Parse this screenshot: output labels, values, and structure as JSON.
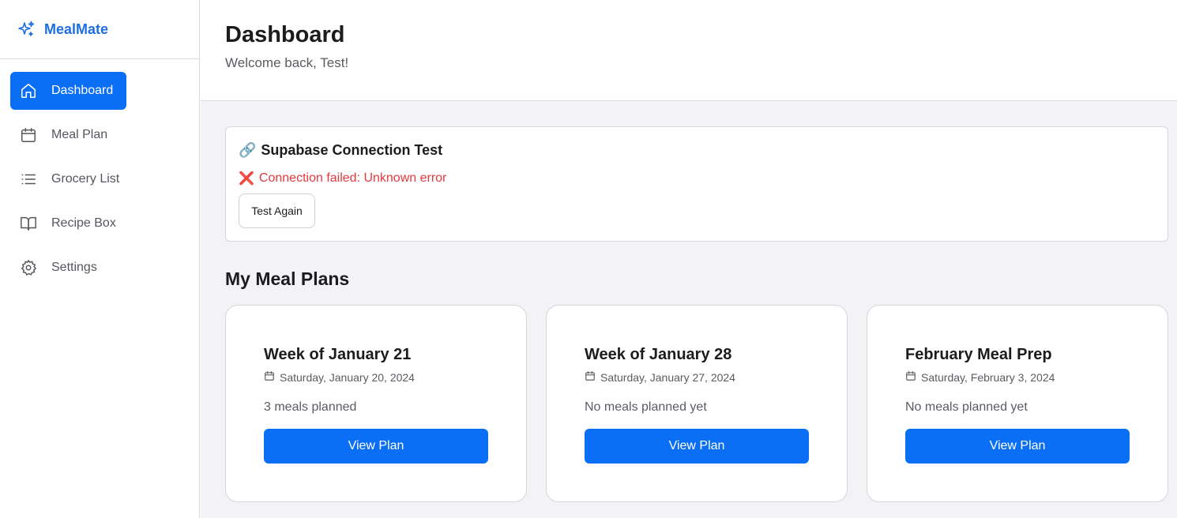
{
  "brand": {
    "name": "MealMate",
    "icon": "sparkles-icon"
  },
  "sidebar": {
    "items": [
      {
        "label": "Dashboard",
        "icon": "home-icon",
        "active": true
      },
      {
        "label": "Meal Plan",
        "icon": "calendar-icon",
        "active": false
      },
      {
        "label": "Grocery List",
        "icon": "list-icon",
        "active": false
      },
      {
        "label": "Recipe Box",
        "icon": "book-icon",
        "active": false
      },
      {
        "label": "Settings",
        "icon": "gear-icon",
        "active": false
      }
    ]
  },
  "header": {
    "title": "Dashboard",
    "subtitle": "Welcome back, Test!"
  },
  "connection": {
    "title": "Supabase Connection Test",
    "title_icon": "🔗",
    "error_icon": "❌",
    "error": "Connection failed: Unknown error",
    "button": "Test Again"
  },
  "meal_plans": {
    "title": "My Meal Plans",
    "cards": [
      {
        "name": "Week of January 21",
        "date": "Saturday, January 20, 2024",
        "status": "3 meals planned",
        "button": "View Plan"
      },
      {
        "name": "Week of January 28",
        "date": "Saturday, January 27, 2024",
        "status": "No meals planned yet",
        "button": "View Plan"
      },
      {
        "name": "February Meal Prep",
        "date": "Saturday, February 3, 2024",
        "status": "No meals planned yet",
        "button": "View Plan"
      }
    ]
  },
  "colors": {
    "accent": "#0b6ff6",
    "brand": "#1f6fe0",
    "error": "#e5393d",
    "background": "#f3f3f5"
  }
}
